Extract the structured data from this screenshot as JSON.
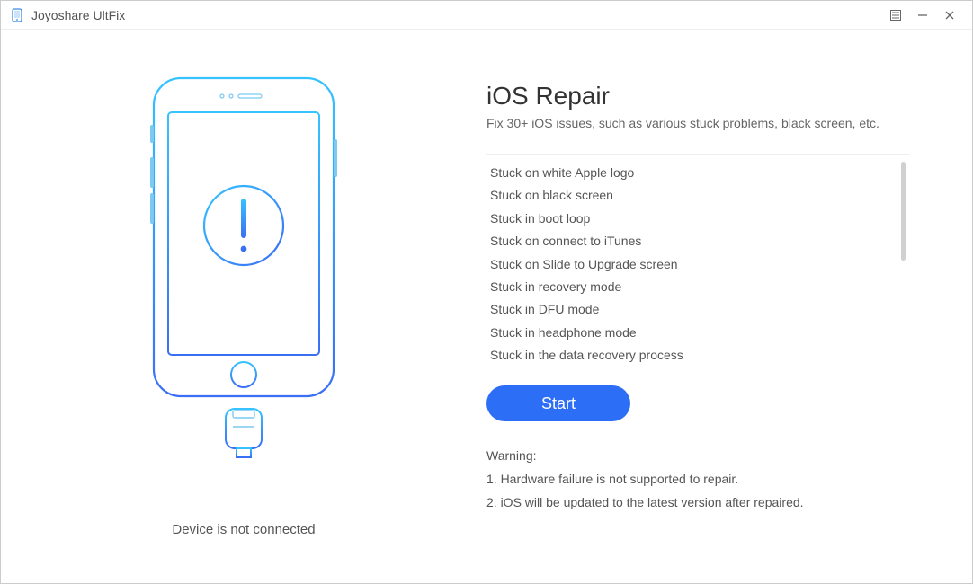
{
  "window": {
    "title": "Joyoshare UltFix"
  },
  "left": {
    "status_text": "Device is not connected"
  },
  "right": {
    "heading": "iOS Repair",
    "subheading": "Fix 30+ iOS issues, such as various stuck problems, black screen, etc.",
    "issues": [
      "Stuck on white Apple logo",
      "Stuck on black screen",
      "Stuck in boot loop",
      "Stuck on connect to iTunes",
      "Stuck on Slide to Upgrade screen",
      "Stuck in recovery mode",
      "Stuck in DFU mode",
      "Stuck in headphone mode",
      "Stuck in the data recovery process"
    ],
    "start_label": "Start",
    "warning_title": "Warning:",
    "warnings": [
      "1. Hardware failure is not supported to repair.",
      "2. iOS will be updated to the latest version after repaired."
    ]
  }
}
